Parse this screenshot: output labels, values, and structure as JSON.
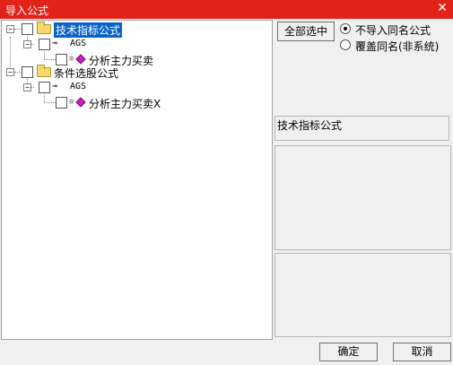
{
  "window": {
    "title": "导入公式",
    "close_glyph": "✕"
  },
  "tree": {
    "groups": [
      {
        "label": "技术指标公式",
        "selected": true,
        "children": [
          {
            "key_icon": "⊸",
            "label": "AGS",
            "children": [
              {
                "label": "分析主力买卖"
              }
            ]
          }
        ]
      },
      {
        "label": "条件选股公式",
        "selected": false,
        "children": [
          {
            "key_icon": "⊸",
            "label": "AGS",
            "children": [
              {
                "label": "分析主力买卖X"
              }
            ]
          }
        ]
      }
    ],
    "expander_glyph": "−",
    "small_icon_glyph": "≡"
  },
  "options": {
    "select_all_label": "全部选中",
    "radio_1_label": "不导入同名公式",
    "radio_1_checked": true,
    "radio_2_label": "覆盖同名(非系统)",
    "radio_2_checked": false
  },
  "info": {
    "category_label": "技术指标公式"
  },
  "footer": {
    "ok_label": "确定",
    "cancel_label": "取消"
  },
  "colors": {
    "titlebar": "#e2231a",
    "selection": "#0a64c8",
    "diamond": "#c820c8"
  }
}
